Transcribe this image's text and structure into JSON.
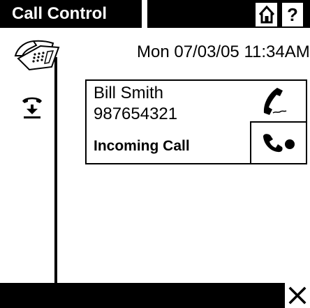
{
  "header": {
    "title": "Call Control",
    "help_label": "?"
  },
  "status": {
    "datetime": "Mon 07/03/05 11:34AM"
  },
  "call": {
    "caller_name": "Bill Smith",
    "caller_number": "987654321",
    "state": "Incoming Call"
  },
  "icons": {
    "home": "home-icon",
    "help": "help-icon",
    "phone_base": "desk-phone-icon",
    "answer": "answer-call-icon",
    "handset": "handset-icon",
    "forward": "call-forward-icon",
    "close": "close-icon"
  },
  "colors": {
    "bar": "#000000",
    "background": "#ffffff"
  }
}
